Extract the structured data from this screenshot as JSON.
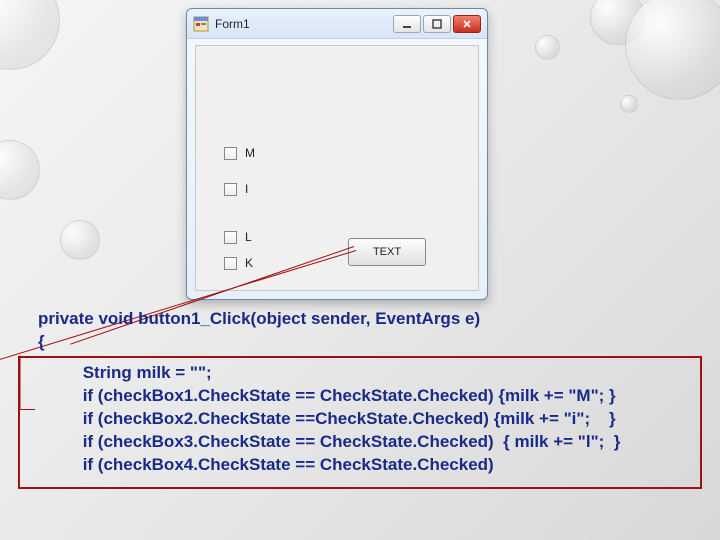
{
  "window": {
    "title": "Form1",
    "checkboxes": [
      {
        "label": "M"
      },
      {
        "label": "I"
      },
      {
        "label": "L"
      },
      {
        "label": "K"
      }
    ],
    "button_label": "TEXT"
  },
  "code": {
    "header_line1": "private void button1_Click(object sender, EventArgs e)",
    "header_line2": "        {",
    "body": "            String milk = \"\";\n            if (checkBox1.CheckState == CheckState.Checked) {milk += \"M\"; }\n            if (checkBox2.CheckState ==CheckState.Checked) {milk += \"i\";    }\n            if (checkBox3.CheckState == CheckState.Checked)  { milk += \"l\";  }\n            if (checkBox4.CheckState == CheckState.Checked)"
  }
}
